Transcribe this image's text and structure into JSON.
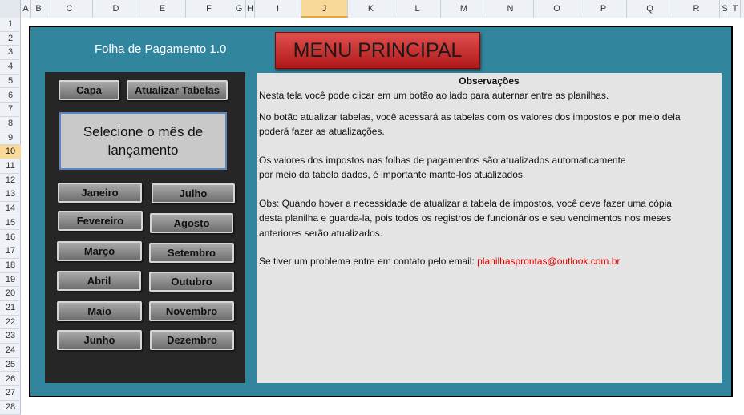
{
  "columns": [
    {
      "label": "A",
      "w": 13
    },
    {
      "label": "B",
      "w": 19
    },
    {
      "label": "C",
      "w": 58
    },
    {
      "label": "D",
      "w": 58
    },
    {
      "label": "E",
      "w": 58
    },
    {
      "label": "F",
      "w": 58
    },
    {
      "label": "G",
      "w": 17
    },
    {
      "label": "H",
      "w": 11
    },
    {
      "label": "I",
      "w": 58
    },
    {
      "label": "J",
      "w": 58,
      "selected": true
    },
    {
      "label": "K",
      "w": 58
    },
    {
      "label": "L",
      "w": 58
    },
    {
      "label": "M",
      "w": 58
    },
    {
      "label": "N",
      "w": 58
    },
    {
      "label": "O",
      "w": 58
    },
    {
      "label": "P",
      "w": 58
    },
    {
      "label": "Q",
      "w": 58
    },
    {
      "label": "R",
      "w": 58
    },
    {
      "label": "S",
      "w": 13
    },
    {
      "label": "T",
      "w": 13
    }
  ],
  "rows": [
    "1",
    "2",
    "3",
    "4",
    "5",
    "6",
    "7",
    "8",
    "9",
    "10",
    "11",
    "12",
    "13",
    "14",
    "15",
    "16",
    "17",
    "18",
    "19",
    "20",
    "21",
    "22",
    "23",
    "24",
    "25",
    "26",
    "27",
    "28"
  ],
  "selected_row": "10",
  "app_title": "Folha de Pagamento 1.0",
  "menu_button": "MENU PRINCIPAL",
  "top_buttons": {
    "capa": "Capa",
    "atualizar": "Atualizar Tabelas"
  },
  "select_month": "Selecione  o mês de lançamento",
  "months": {
    "janeiro": "Janeiro",
    "julho": "Julho",
    "fevereiro": "Fevereiro",
    "agosto": "Agosto",
    "marco": "Março",
    "setembro": "Setembro",
    "abril": "Abril",
    "outubro": "Outubro",
    "maio": "Maio",
    "novembro": "Novembro",
    "junho": "Junho",
    "dezembro": "Dezembro"
  },
  "observations": {
    "title": "Observações",
    "l1": "Nesta tela você pode clicar em um botão ao lado para auternar entre as planilhas.",
    "l2": "No botão atualizar tabelas, você acessará as tabelas com os valores dos impostos e por meio dela",
    "l3": "poderá fazer as atualizações.",
    "l4": "Os valores dos impostos nas folhas de pagamentos são atualizados automaticamente",
    "l5": "por meio da tabela dados, é importante mante-los atualizados.",
    "l6": "Obs: Quando hover a necessidade de atualizar a tabela de impostos, você deve fazer uma cópia",
    "l7": "desta planilha e guarda-la, pois todos os registros de funcionários e seu vencimentos nos meses",
    "l8": "anteriores serão atualizados.",
    "l9": "Se tiver um problema entre em contato pelo email: ",
    "email": "planilhasprontas@outlook.com.br"
  }
}
